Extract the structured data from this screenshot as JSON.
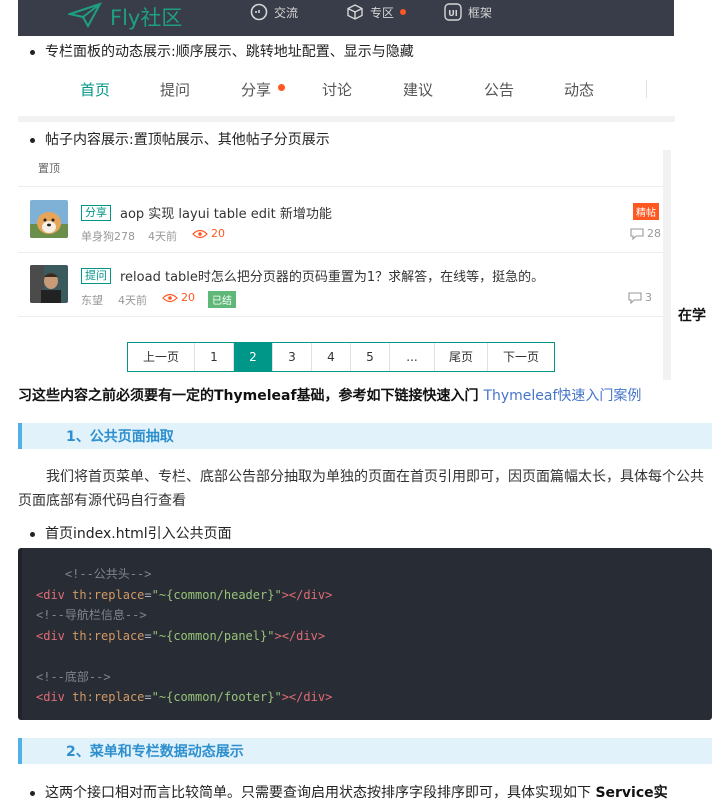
{
  "header": {
    "brand": "Fly社区",
    "nav": [
      {
        "icon": "chat-icon",
        "label": "交流"
      },
      {
        "icon": "cube-icon",
        "label": "专区"
      },
      {
        "icon": "ui-icon",
        "label": "框架"
      }
    ]
  },
  "bullets": {
    "b1": "专栏面板的动态展示:顺序展示、跳转地址配置、显示与隐藏",
    "b2": "帖子内容展示:置顶帖展示、其他帖子分页展示",
    "b3": "首页index.html引入公共页面",
    "b4a": "这两个接口相对而言比较简单。只需要查询启用状态按排序字段排序即可，具体实现如下 ",
    "b4b": "Service实"
  },
  "panel": {
    "tabs": [
      "首页",
      "提问",
      "分享",
      "讨论",
      "建议",
      "公告",
      "动态"
    ]
  },
  "posts": {
    "pinned_label": "置顶",
    "items": [
      {
        "tag": "分享",
        "title": "aop 实现 layui table edit 新增功能",
        "author": "单身狗278",
        "time": "4天前",
        "views": "20",
        "badge": "精帖",
        "comments": "28"
      },
      {
        "tag": "提问",
        "title": "reload table时怎么把分页器的页码重置为1？求解答，在线等，挺急的。",
        "author": "东望",
        "time": "4天前",
        "views": "20",
        "badge": "已结",
        "comments": "3"
      }
    ]
  },
  "pager": [
    "上一页",
    "1",
    "2",
    "3",
    "4",
    "5",
    "...",
    "尾页",
    "下一页"
  ],
  "intro": {
    "line1_tail": "在学",
    "line2": "习这些内容之前必须要有一定的Thymeleaf基础，参考如下链接快速入门 ",
    "link": "Thymeleaf快速入门案例"
  },
  "section1": {
    "heading": "1、公共页面抽取",
    "para": "我们将首页菜单、专栏、底部公告部分抽取为单独的页面在首页引用即可，因页面篇幅太长，具体每个公共页面底部有源代码自行查看"
  },
  "code": {
    "c1": "<!--公共头-->",
    "c2": "<!--导航栏信息-->",
    "c3": "<!--底部-->",
    "tag": "div",
    "attr": "th:replace",
    "v1": "\"~{common/header}\"",
    "v2": "\"~{common/panel}\"",
    "v3": "\"~{common/footer}\""
  },
  "section2": {
    "heading": "2、菜单和专栏数据动态展示"
  },
  "colors": {
    "accent": "#009688",
    "hot": "#ff5722",
    "heading": "#2e8fce"
  }
}
